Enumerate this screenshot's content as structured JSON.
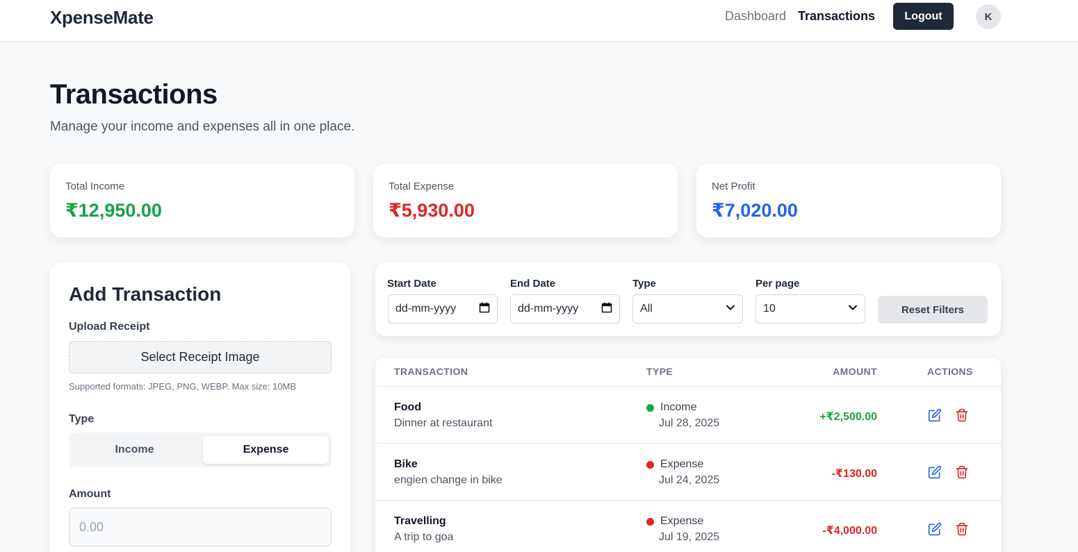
{
  "nav": {
    "brand": "XpenseMate",
    "links": [
      {
        "label": "Dashboard",
        "active": false
      },
      {
        "label": "Transactions",
        "active": true
      }
    ],
    "logout_label": "Logout",
    "avatar_initial": "K"
  },
  "page": {
    "title": "Transactions",
    "subtitle": "Manage your income and expenses all in one place."
  },
  "stats": [
    {
      "label": "Total Income",
      "value": "₹12,950.00",
      "color": "#16a34a"
    },
    {
      "label": "Total Expense",
      "value": "₹5,930.00",
      "color": "#dc2626"
    },
    {
      "label": "Net Profit",
      "value": "₹7,020.00",
      "color": "#2563eb"
    }
  ],
  "form": {
    "title": "Add Transaction",
    "upload_label": "Upload Receipt",
    "upload_button": "Select Receipt Image",
    "upload_hint": "Supported formats: JPEG, PNG, WEBP. Max size: 10MB",
    "type_label": "Type",
    "type_options": [
      "Income",
      "Expense"
    ],
    "type_selected": "Expense",
    "amount_label": "Amount",
    "amount_placeholder": "0.00"
  },
  "filters": {
    "start_date_label": "Start Date",
    "start_date_value": "dd-mm-yyyy",
    "end_date_label": "End Date",
    "end_date_value": "dd-mm-yyyy",
    "type_label": "Type",
    "type_value": "All",
    "per_page_label": "Per page",
    "per_page_value": "10",
    "reset_label": "Reset Filters"
  },
  "table": {
    "headers": {
      "transaction": "TRANSACTION",
      "type": "TYPE",
      "amount": "AMOUNT",
      "actions": "ACTIONS"
    },
    "rows": [
      {
        "title": "Food",
        "description": "Dinner at restaurant",
        "type": "Income",
        "date": "Jul 28, 2025",
        "amount": "+₹2,500.00",
        "color": "#16a34a"
      },
      {
        "title": "Bike",
        "description": "engien change in bike",
        "type": "Expense",
        "date": "Jul 24, 2025",
        "amount": "-₹130.00",
        "color": "#dc2626"
      },
      {
        "title": "Travelling",
        "description": "A trip to goa",
        "type": "Expense",
        "date": "Jul 19, 2025",
        "amount": "-₹4,000.00",
        "color": "#dc2626"
      }
    ]
  },
  "colors": {
    "income": "#16a34a",
    "expense": "#dc2626",
    "net": "#2563eb",
    "edit_icon": "#2563eb",
    "delete_icon": "#dc2626",
    "dark": "#1f2937"
  }
}
